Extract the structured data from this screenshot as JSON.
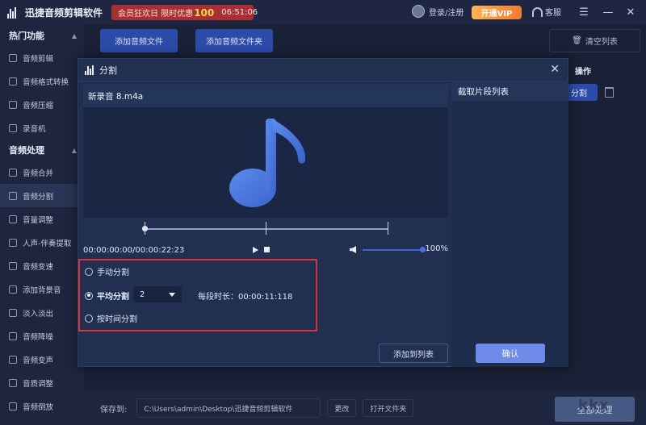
{
  "app": {
    "title": "迅捷音频剪辑软件",
    "promo_text": "会员狂欢日 限时优惠",
    "promo_number": "100",
    "promo_timer": "06:51:06",
    "login_label": "登录/注册",
    "vip_label": "开通VIP",
    "service_label": "客服"
  },
  "sidebar": {
    "section1": "热门功能",
    "items1": [
      "音频剪辑",
      "音频格式转换",
      "音频压缩",
      "录音机"
    ],
    "section2": "音频处理",
    "items2": [
      "音频合并",
      "音频分割",
      "音量调整",
      "人声-伴奏提取",
      "音频变速",
      "添加背景音",
      "淡入淡出",
      "音频降噪",
      "音频变声",
      "音质调整",
      "音频倒放"
    ]
  },
  "toolbar": {
    "add_file": "添加音频文件",
    "add_folder": "添加音频文件夹",
    "clear_list": "清空列表",
    "ops_header": "操作",
    "split_button": "分割"
  },
  "bottom": {
    "save_label": "保存到:",
    "save_path": "C:\\Users\\admin\\Desktop\\迅捷音频剪辑软件",
    "change": "更改",
    "open_folder": "打开文件夹",
    "process_all": "全部处理",
    "watermark": "kkx"
  },
  "dialog": {
    "title": "分割",
    "file_name": "新录音 8.m4a",
    "time_display": "00:00:00:00/00:00:22:23",
    "volume": "100%",
    "options": {
      "manual": "手动分割",
      "average": "平均分割",
      "by_time": "按时间分割",
      "selected": "average"
    },
    "split_count": "2",
    "segment_duration_label": "每段时长：",
    "segment_duration": "00:00:11:118",
    "clip_list_title": "截取片段列表",
    "add_to_list": "添加到列表",
    "confirm": "确认"
  },
  "colors": {
    "accent": "#2c4aa8",
    "confirm": "#6f8bea",
    "highlight_box": "#d6343e",
    "note_icon": "#4f7ee0"
  }
}
